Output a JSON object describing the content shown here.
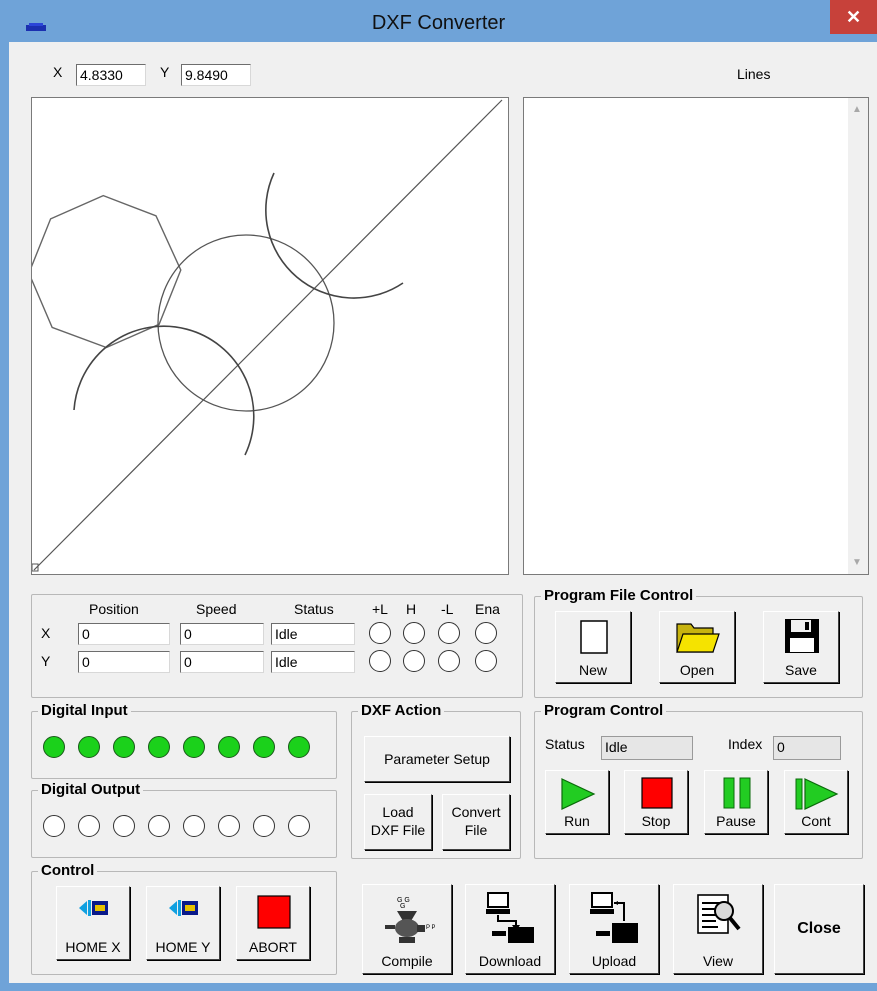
{
  "window": {
    "title": "DXF Converter",
    "close_glyph": "✕"
  },
  "coords": {
    "x_label": "X",
    "x_value": "4.8330",
    "y_label": "Y",
    "y_value": "9.8490"
  },
  "lines_panel": {
    "label": "Lines"
  },
  "axes_table": {
    "headers": {
      "position": "Position",
      "speed": "Speed",
      "status": "Status",
      "plus_l": "+L",
      "h": "H",
      "minus_l": "-L",
      "ena": "Ena"
    },
    "rows": [
      {
        "axis": "X",
        "position": "0",
        "speed": "0",
        "status": "Idle"
      },
      {
        "axis": "Y",
        "position": "0",
        "speed": "0",
        "status": "Idle"
      }
    ]
  },
  "program_file_control": {
    "title": "Program File Control",
    "new_label": "New",
    "open_label": "Open",
    "save_label": "Save"
  },
  "digital_input": {
    "title": "Digital Input",
    "states": [
      true,
      true,
      true,
      true,
      true,
      true,
      true,
      true
    ]
  },
  "digital_output": {
    "title": "Digital Output",
    "states": [
      false,
      false,
      false,
      false,
      false,
      false,
      false,
      false
    ]
  },
  "dxf_action": {
    "title": "DXF Action",
    "parameter_setup": "Parameter Setup",
    "load_line1": "Load",
    "load_line2": "DXF File",
    "convert_line1": "Convert",
    "convert_line2": "File"
  },
  "program_control": {
    "title": "Program Control",
    "status_label": "Status",
    "status_value": "Idle",
    "index_label": "Index",
    "index_value": "0",
    "run_label": "Run",
    "stop_label": "Stop",
    "pause_label": "Pause",
    "cont_label": "Cont"
  },
  "control": {
    "title": "Control",
    "home_x": "HOME X",
    "home_y": "HOME Y",
    "abort": "ABORT"
  },
  "toolbar": {
    "compile": "Compile",
    "download": "Download",
    "upload": "Upload",
    "view": "View",
    "close": "Close"
  },
  "colors": {
    "led_on": "#1bd11b",
    "stop_red": "#ff0000",
    "play_green": "#22cc22",
    "title_bar": "#6fa3d8"
  }
}
